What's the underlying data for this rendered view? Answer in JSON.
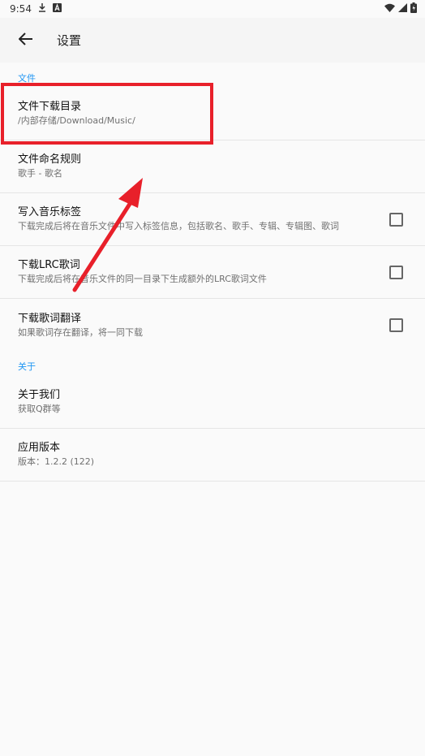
{
  "status_bar": {
    "time": "9:54",
    "left_icons": [
      "download-icon",
      "a-box-icon"
    ],
    "right_icons": [
      "wifi-icon",
      "signal-icon",
      "battery-icon"
    ]
  },
  "toolbar": {
    "title": "设置",
    "back_icon": "arrow-back-icon"
  },
  "sections": [
    {
      "header": "文件",
      "items": [
        {
          "title": "文件下载目录",
          "summary": "/内部存储/Download/Music/"
        },
        {
          "title": "文件命名规则",
          "summary": "歌手 - 歌名"
        },
        {
          "title": "写入音乐标签",
          "summary": "下载完成后将在音乐文件中写入标签信息，包括歌名、歌手、专辑、专辑图、歌词",
          "checkbox": false
        },
        {
          "title": "下载LRC歌词",
          "summary": "下载完成后将在音乐文件的同一目录下生成额外的LRC歌词文件",
          "checkbox": false
        },
        {
          "title": "下载歌词翻译",
          "summary": "如果歌词存在翻译，将一同下载",
          "checkbox": false
        }
      ]
    },
    {
      "header": "关于",
      "items": [
        {
          "title": "关于我们",
          "summary": "获取Q群等"
        },
        {
          "title": "应用版本",
          "summary": "版本：1.2.2 (122)"
        }
      ]
    }
  ],
  "annotations": {
    "highlight_color": "#e8202a",
    "accent_color": "#2196f3"
  }
}
